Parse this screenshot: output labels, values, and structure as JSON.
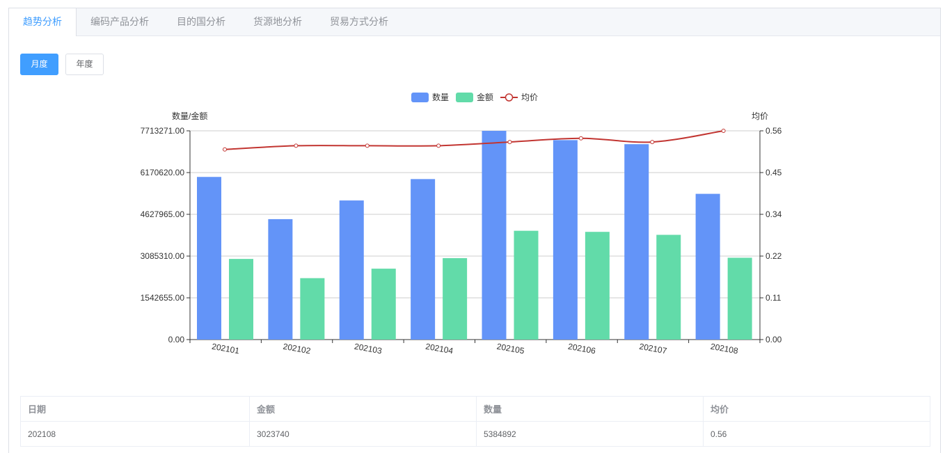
{
  "tabs": [
    "趋势分析",
    "编码产品分析",
    "目的国分析",
    "货源地分析",
    "贸易方式分析"
  ],
  "active_tab": 0,
  "period_buttons": [
    "月度",
    "年度"
  ],
  "active_period": 0,
  "chart_data": {
    "type": "bar",
    "categories": [
      "202101",
      "202102",
      "202103",
      "202104",
      "202105",
      "202106",
      "202107",
      "202108"
    ],
    "series": [
      {
        "name": "数量",
        "type": "bar",
        "axis": "left",
        "color": "#6394f8",
        "values": [
          6010000,
          4450000,
          5140000,
          5930000,
          7713271,
          7370000,
          7220000,
          5384892
        ]
      },
      {
        "name": "金额",
        "type": "bar",
        "axis": "left",
        "color": "#62dba9",
        "values": [
          2980000,
          2270000,
          2620000,
          3010000,
          4020000,
          3980000,
          3870000,
          3023740
        ]
      },
      {
        "name": "均价",
        "type": "line",
        "axis": "right",
        "color": "#c23531",
        "values": [
          0.51,
          0.52,
          0.52,
          0.52,
          0.53,
          0.54,
          0.53,
          0.56
        ]
      }
    ],
    "ylabel_left": "数量/金额",
    "ylabel_right": "均价",
    "ylim_left": [
      0,
      7713271
    ],
    "ylim_right": [
      0,
      0.56
    ],
    "yticks_left": [
      "0.00",
      "1542655.00",
      "3085310.00",
      "4627965.00",
      "6170620.00",
      "7713271.00"
    ],
    "yticks_right": [
      "0.00",
      "0.11",
      "0.22",
      "0.34",
      "0.45",
      "0.56"
    ],
    "legend_position": "top-center",
    "grid": true
  },
  "table": {
    "headers": [
      "日期",
      "金额",
      "数量",
      "均价"
    ],
    "rows": [
      [
        "202108",
        "3023740",
        "5384892",
        "0.56"
      ]
    ]
  }
}
